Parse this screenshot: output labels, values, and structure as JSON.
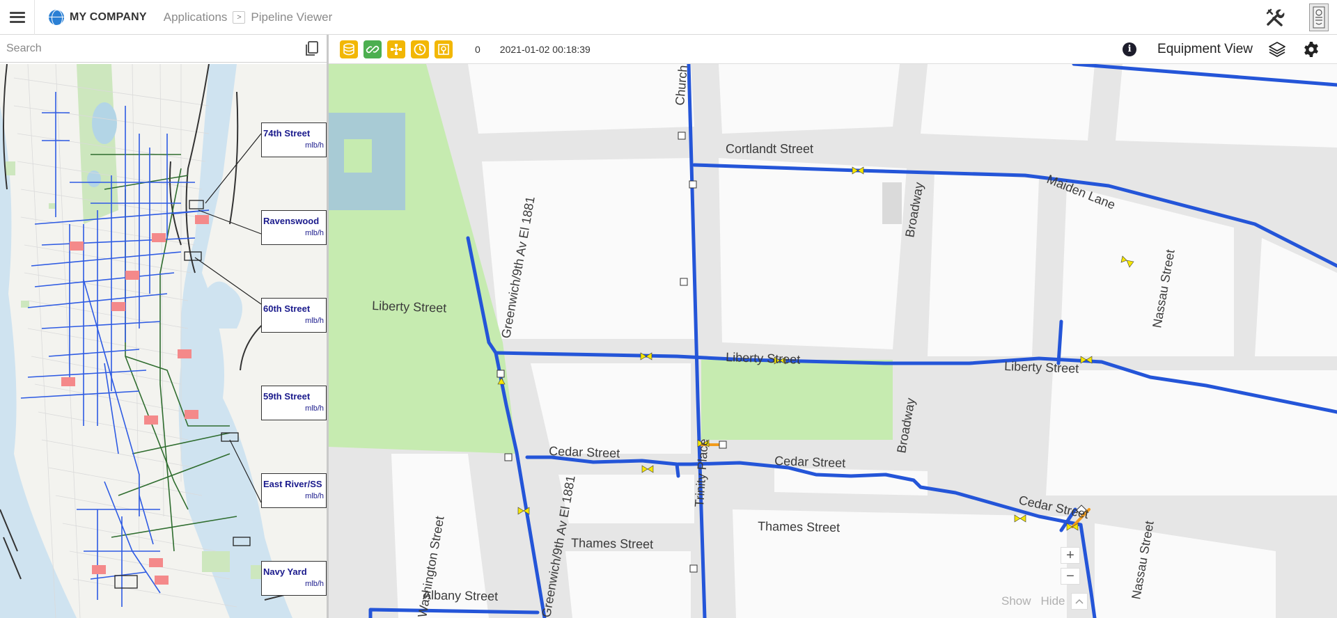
{
  "header": {
    "brand": "MY COMPANY",
    "breadcrumb": {
      "first": "Applications",
      "separator": ">",
      "current": "Pipeline Viewer"
    }
  },
  "search": {
    "placeholder": "Search"
  },
  "toolbar": {
    "count": "0",
    "timestamp": "2021-01-02 00:18:39",
    "view_label": "Equipment View",
    "info": "i",
    "buttons": [
      {
        "name": "pipeline-layer-button",
        "color": "#f2b705"
      },
      {
        "name": "link-button",
        "color": "#4caf50"
      },
      {
        "name": "network-button",
        "color": "#f2b705"
      },
      {
        "name": "history-button",
        "color": "#f2b705"
      },
      {
        "name": "meter-button",
        "color": "#f2b705"
      }
    ]
  },
  "stations": [
    {
      "name": "74th Street",
      "unit": "mlb/h"
    },
    {
      "name": "Ravenswood",
      "unit": "mlb/h"
    },
    {
      "name": "60th Street",
      "unit": "mlb/h"
    },
    {
      "name": "59th Street",
      "unit": "mlb/h"
    },
    {
      "name": "East River/SS",
      "unit": "mlb/h"
    },
    {
      "name": "Navy Yard",
      "unit": "mlb/h"
    }
  ],
  "map": {
    "streets": {
      "cortlandt": "Cortlandt Street",
      "maiden": "Maiden Lane",
      "broadway_upper": "Broadway",
      "broadway_lower": "Broadway",
      "greenwich_upper": "Greenwich/9th Av El 1881",
      "greenwich_lower": "Greenwich/9th Av El 1881",
      "liberty_park": "Liberty Street",
      "liberty_mid": "Liberty Street",
      "liberty_right": "Liberty Street",
      "cedar_left": "Cedar Street",
      "cedar_mid": "Cedar Street",
      "cedar_right": "Cedar Street",
      "trinity": "Trinity Place",
      "thames_left": "Thames Street",
      "thames_right": "Thames Street",
      "albany": "Albany Street",
      "nassau_upper": "Nassau Street",
      "nassau_lower": "Nassau Street",
      "church": "Church",
      "washington": "Washington Street"
    },
    "zoom_in": "+",
    "zoom_out": "−",
    "show": "Show",
    "hide": "Hide",
    "pipe_color": "#2455d8",
    "valve_color": "#f5e600"
  }
}
